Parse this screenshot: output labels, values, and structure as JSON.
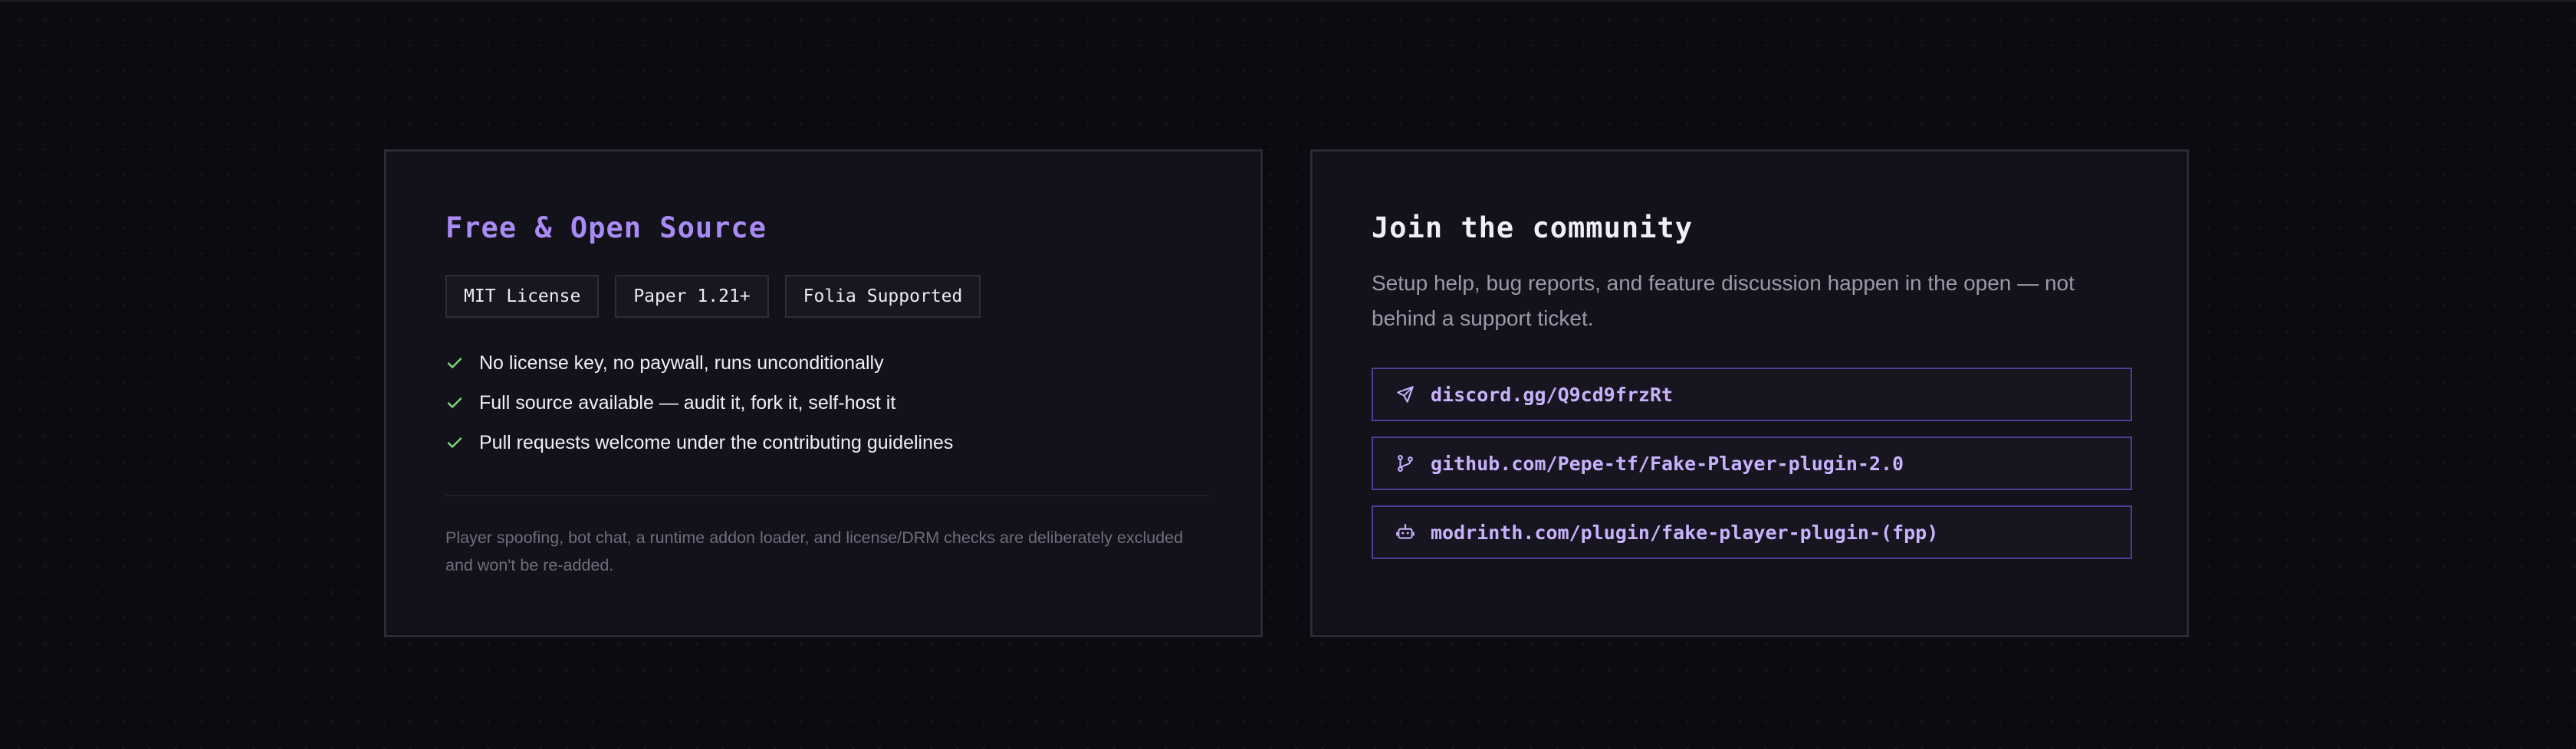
{
  "license_card": {
    "title": "Free & Open Source",
    "badges": [
      "MIT License",
      "Paper 1.21+",
      "Folia Supported"
    ],
    "features": [
      "No license key, no paywall, runs unconditionally",
      "Full source available — audit it, fork it, self-host it",
      "Pull requests welcome under the contributing guidelines"
    ],
    "footnote": "Player spoofing, bot chat, a runtime addon loader, and license/DRM checks are deliberately excluded and won't be re-added."
  },
  "community_card": {
    "title": "Join the community",
    "description": "Setup help, bug reports, and feature discussion happen in the open — not behind a support ticket.",
    "links": [
      {
        "label": "discord.gg/Q9cd9frzRt",
        "icon": "send-icon"
      },
      {
        "label": "github.com/Pepe-tf/Fake-Player-plugin-2.0",
        "icon": "git-branch-icon"
      },
      {
        "label": "modrinth.com/plugin/fake-player-plugin-(fpp)",
        "icon": "bot-icon"
      }
    ]
  },
  "colors": {
    "background": "#0c0b11",
    "card": "#13121a",
    "accent": "#a98bf5",
    "link_text": "#c7b2fb",
    "link_border": "#4d3f96",
    "check": "#7fd67a"
  }
}
